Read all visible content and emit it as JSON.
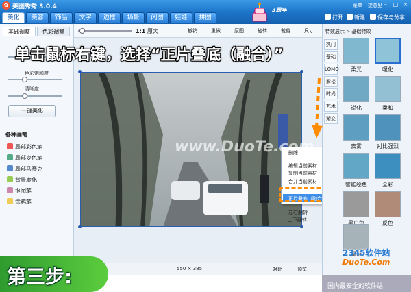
{
  "app": {
    "title": "美图秀秀 3.0.4",
    "top_links": [
      "菜单",
      "提意见"
    ],
    "win_buttons": [
      "–",
      "□",
      "×"
    ]
  },
  "main_tabs": [
    "美化",
    "美容",
    "饰品",
    "文字",
    "边框",
    "场景",
    "闪图",
    "娃娃",
    "拼图"
  ],
  "anniversary": "3周年",
  "toolbar_right": {
    "open": "打开",
    "new": "新建",
    "save": "保存与分享"
  },
  "left_panel": {
    "subtabs": [
      "基础调整",
      "色彩调整"
    ],
    "sliders": [
      {
        "label": "亮度",
        "value": 0.5
      },
      {
        "label": "色彩饱和度",
        "value": 0.3
      },
      {
        "label": "清晰度",
        "value": 0.3
      }
    ],
    "one_key": "一键美化",
    "brushes_title": "各种画笔",
    "brushes": [
      "局部彩色笔",
      "局部变色笔",
      "局部马赛克",
      "背景虚化",
      "抠图笔",
      "涂鸦笔"
    ]
  },
  "canvas_toolbar": {
    "zoom_label": "1:1",
    "zoom_text": "原大",
    "buttons": [
      "撤销",
      "重做",
      "原图",
      "旋转",
      "裁剪",
      "尺寸"
    ]
  },
  "context_menu": {
    "items": [
      "删除",
      "编辑当前素材",
      "复制当前素材",
      "合并当前素材",
      "正片叠底（融合）",
      "左右翻转",
      "上下翻转"
    ],
    "selected_index": 4
  },
  "status_bar": {
    "size": "550 × 385",
    "compare": "对比",
    "preview": "预览"
  },
  "right_panel": {
    "header": "特效展示 > 基础特效",
    "side_tabs": [
      "热门",
      "基础",
      "LOMO",
      "影楼",
      "时尚",
      "艺术",
      "渐变"
    ],
    "effects": [
      "柔光",
      "暖化",
      "锐化",
      "柔和",
      "去雾",
      "对比强烈",
      "智能绘色",
      "全彩",
      "黑白色",
      "反色",
      "晕渐"
    ]
  },
  "overlay": {
    "instruction": "单击鼠标右键，选择“正片叠底（融合）”",
    "step": "第三步:",
    "watermark": "www.DuoTe.com",
    "site_name": "2345软件站",
    "site_domain": "DuoTe.Com",
    "site_tagline": "国内最安全的软件站"
  },
  "colors": {
    "title_bar": "#2a86d8",
    "caption_highlight": "#ff8c00",
    "step_badge": "#3aaa36"
  }
}
